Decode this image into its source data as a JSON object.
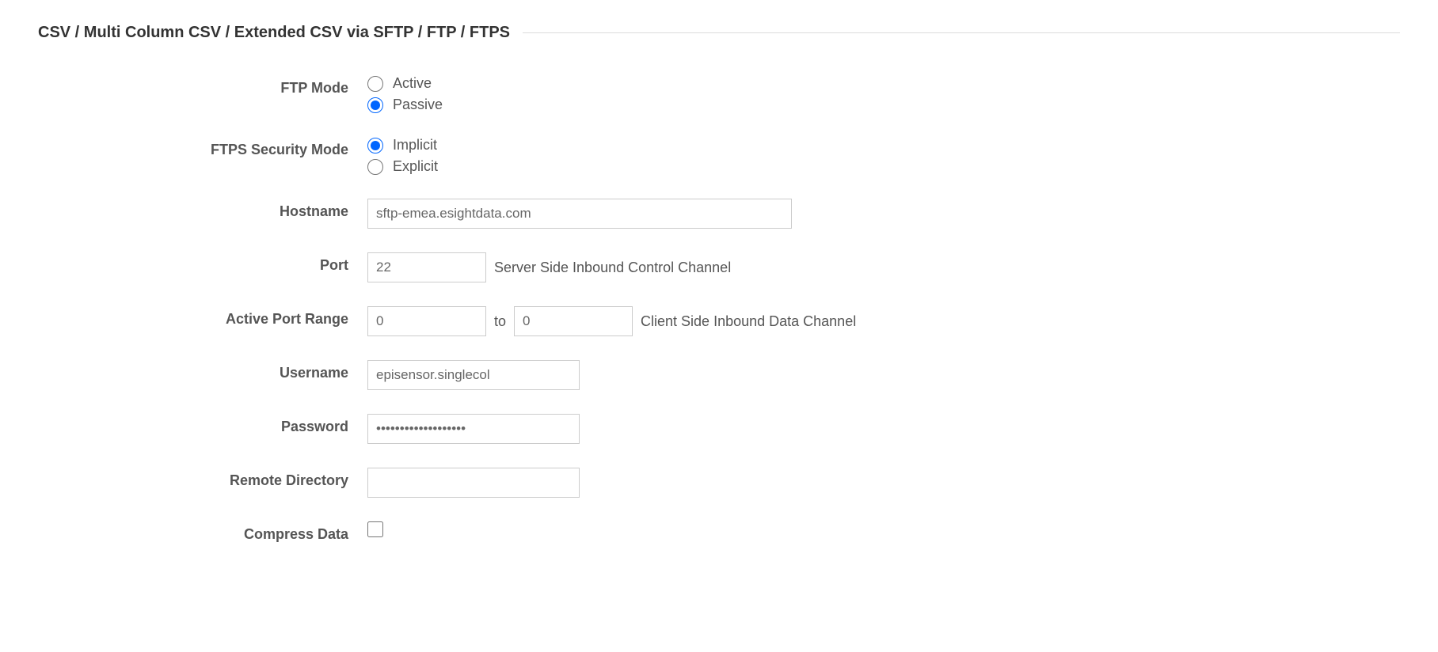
{
  "section": {
    "title": "CSV / Multi Column CSV / Extended CSV via SFTP / FTP / FTPS"
  },
  "labels": {
    "ftp_mode": "FTP Mode",
    "ftps_security_mode": "FTPS Security Mode",
    "hostname": "Hostname",
    "port": "Port",
    "active_port_range": "Active Port Range",
    "username": "Username",
    "password": "Password",
    "remote_directory": "Remote Directory",
    "compress_data": "Compress Data"
  },
  "options": {
    "ftp_mode": {
      "active": "Active",
      "passive": "Passive"
    },
    "ftps_security_mode": {
      "implicit": "Implicit",
      "explicit": "Explicit"
    }
  },
  "values": {
    "hostname": "sftp-emea.esightdata.com",
    "port": "22",
    "active_port_from": "0",
    "active_port_to": "0",
    "username": "episensor.singlecol",
    "password": "•••••••••••••••••••",
    "remote_directory": ""
  },
  "text": {
    "port_help": "Server Side Inbound Control Channel",
    "port_range_to": "to",
    "port_range_help": "Client Side Inbound Data Channel"
  }
}
